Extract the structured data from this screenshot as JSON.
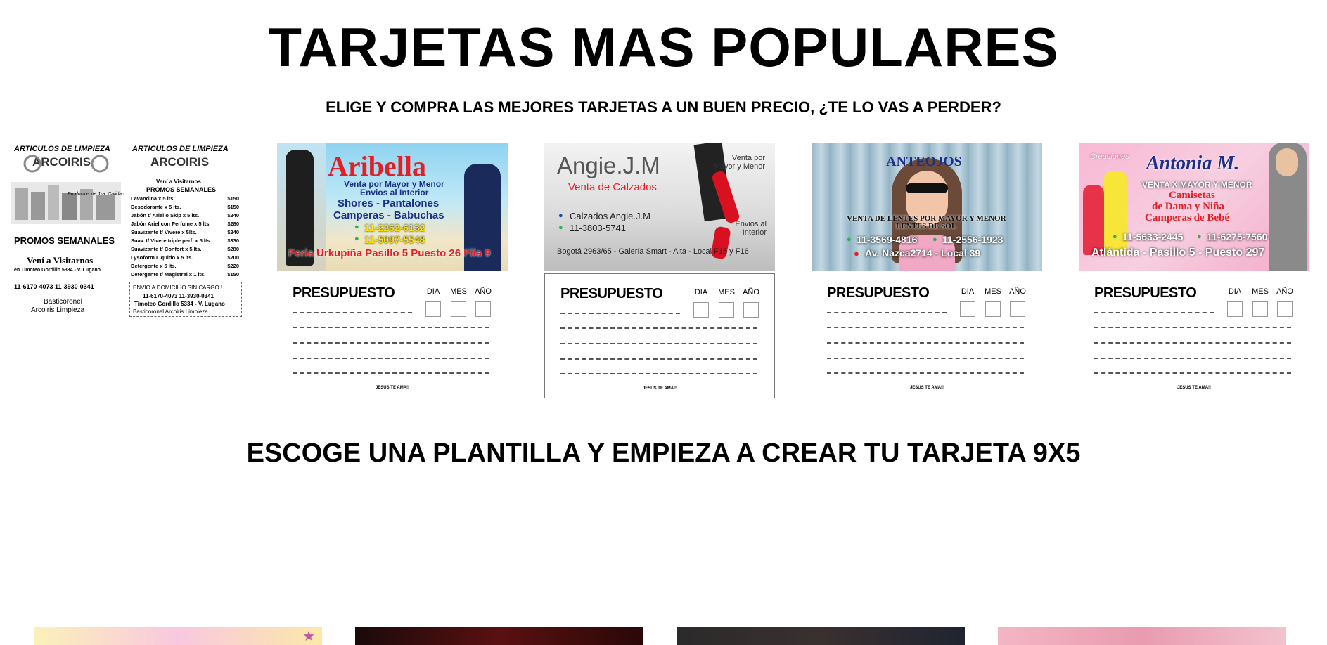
{
  "header": {
    "title": "TARJETAS MAS POPULARES",
    "subtitle": "ELIGE Y COMPRA LAS MEJORES TARJETAS A UN BUEN PRECIO, ¿TE LO VAS A PERDER?"
  },
  "back_labels": {
    "presupuesto": "PRESUPUESTO",
    "dia": "DIA",
    "mes": "MES",
    "anio": "AÑO",
    "footer": "JESUS TE AMA!!"
  },
  "card_limpieza": {
    "heading": "ARTICULOS DE LIMPIEZA",
    "brand": "ARCOIRIS",
    "quality": "Productos de 1ra. Calidad",
    "promos": "PROMOS SEMANALES",
    "visit_title": "Vení a Visitarnos",
    "visit_sub": "Vení a Visitarnos",
    "address": "en Timoteo Gordillo 5334 - V. Lugano",
    "phones": "11-6170-4073  11-3930-0341",
    "instagram": "Basticoronel",
    "facebook": "Arcoiris Limpieza",
    "envio": "ENVIO A DOMICILIO SIN CARGO !",
    "address2": "Timoteo Gordillo 5334 - V. Lugano",
    "social2": "Basticoronel  Arcoiris Limpieza",
    "prices": [
      {
        "item": "Lavandina x 5 lts.",
        "price": "$150"
      },
      {
        "item": "Desodorante x 5 lts.",
        "price": "$150"
      },
      {
        "item": "Jabón t/ Ariel o Skip x 5 lts.",
        "price": "$240"
      },
      {
        "item": "Jabón Ariel con Perfume x 5 lts.",
        "price": "$280"
      },
      {
        "item": "Suavizante t/ Vivere x 5lts.",
        "price": "$240"
      },
      {
        "item": "Suav. t/ Vivere triple perf. x 5 lts.",
        "price": "$330"
      },
      {
        "item": "Suavizante t/ Confort x 5 lts.",
        "price": "$280"
      },
      {
        "item": "Lysoform Liquido x 5 lts.",
        "price": "$200"
      },
      {
        "item": "Detergente x 5 lts.",
        "price": "$220"
      },
      {
        "item": "Detergente t/ Magistral x 1 lts.",
        "price": "$150"
      }
    ]
  },
  "card_aribella": {
    "name": "Aribella",
    "line1": "Venta por Mayor y Menor",
    "line2": "Envios al Interior",
    "line3": "Shores - Pantalones",
    "line4": "Camperas - Babuchas",
    "phone1": "11-2262-6132",
    "phone2": "11-5097-5548",
    "location": "Feria Urkupiña Pasillo 5 Puesto 26 Fila 9"
  },
  "card_angie": {
    "name": "Angie.J.M",
    "tagline": "Venta de Calzados",
    "side1": "Venta por Mayor y Menor",
    "side2": "Envios al Interior",
    "facebook": "Calzados Angie.J.M",
    "phone": "11-3803-5741",
    "address": "Bogotá 2963/65 - Galería Smart - Alta - Local F15 y F16"
  },
  "card_anteojos": {
    "name": "ANTEOJOS",
    "line1": "VENTA DE LENTES POR MAYOR Y MENOR",
    "line2": "LENTES DE SOL",
    "phone1": "11-3569-4816",
    "phone2": "11-2556-1923",
    "address": "Av. Nazca2714 - Local 39"
  },
  "card_antonia": {
    "prefix": "Creaciones",
    "name": "Antonia M.",
    "line1": "VENTA X MAYOR Y MENOR",
    "line2": "Camisetas",
    "line3": "de Dama y Niña",
    "line4": "Camperas de Bebé",
    "phone1": "11-5633-2445",
    "phone2": "11-6275-7560",
    "address": "Atlántida - Pasillo 5 - Puesto 297"
  },
  "section": {
    "title": "ESCOGE UNA PLANTILLA Y EMPIEZA A CREAR TU TARJETA 9X5"
  },
  "colors": {
    "aribella_red": "#e31e24",
    "phone_yellow": "#ffe600",
    "antonia_pink": "#f28cb8",
    "anteojos_blue": "#1b2f8c"
  }
}
